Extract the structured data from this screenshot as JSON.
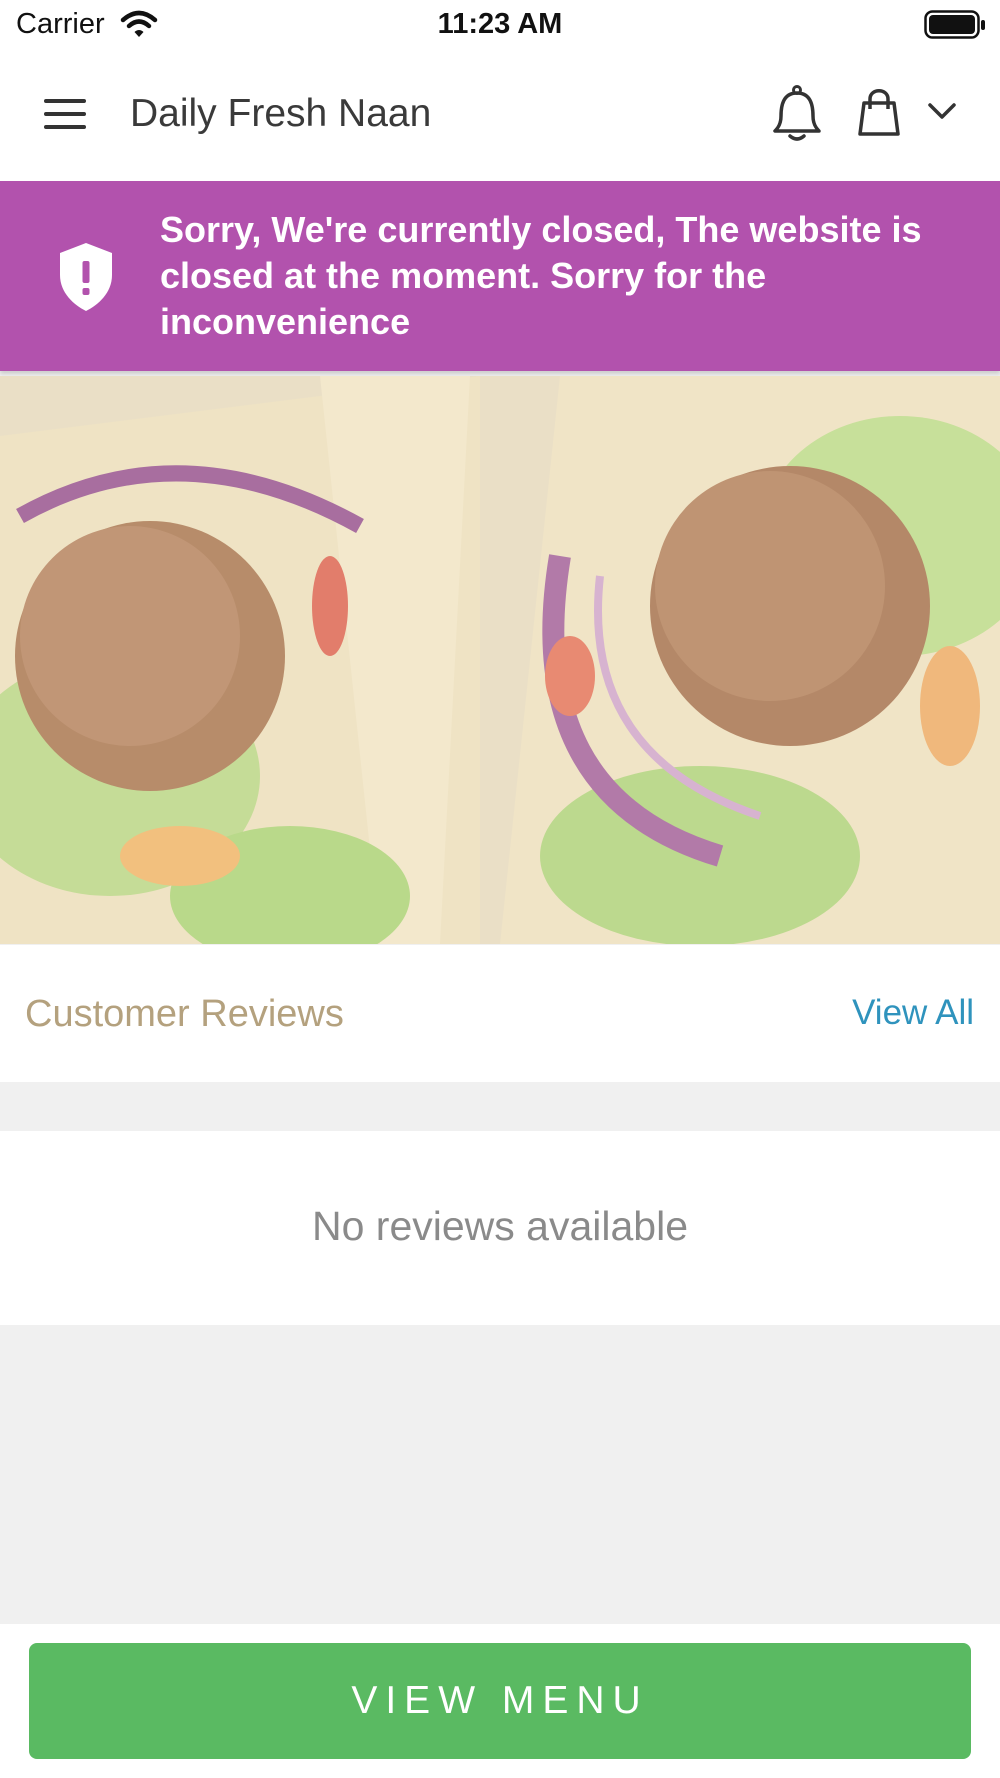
{
  "status_bar": {
    "carrier": "Carrier",
    "time": "11:23 AM"
  },
  "header": {
    "title": "Daily Fresh Naan",
    "icons": [
      "menu-icon",
      "bell-icon",
      "shopping-bag-icon",
      "chevron-down-icon"
    ]
  },
  "banner": {
    "message": "Sorry, We're currently closed, The website is closed at the moment. Sorry for the inconvenience",
    "icon": "shield-alert-icon",
    "color": "#b252ad"
  },
  "hero": {
    "image": "falafel-wraps-photo"
  },
  "reviews": {
    "title": "Customer Reviews",
    "view_all": "View All",
    "empty_text": "No reviews available"
  },
  "cta": {
    "label": "VIEW MENU",
    "color": "#5aba62"
  }
}
